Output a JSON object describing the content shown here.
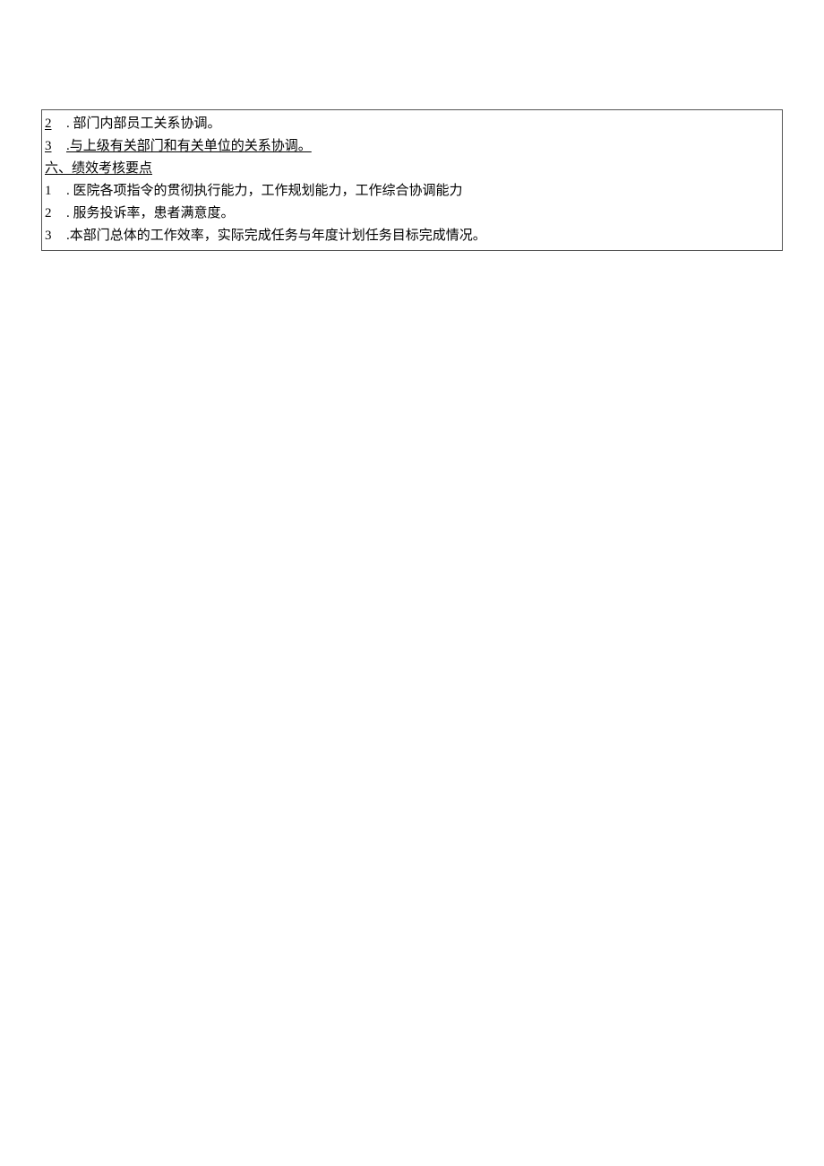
{
  "section_a": {
    "items": [
      {
        "num": "2",
        "text": ". 部门内部员工关系协调。",
        "num_underlined": true,
        "text_underlined": false
      },
      {
        "num": "3",
        "text": ".与上级有关部门和有关单位的关系协调。",
        "num_underlined": true,
        "text_underlined": true
      }
    ]
  },
  "section_b": {
    "heading": "六、绩效考核要点",
    "heading_underlined": true,
    "items": [
      {
        "num": "1",
        "text": ". 医院各项指令的贯彻执行能力，工作规划能力，工作综合协调能力"
      },
      {
        "num": "2",
        "text": ". 服务投诉率，患者满意度。"
      },
      {
        "num": "3",
        "text": ".本部门总体的工作效率，实际完成任务与年度计划任务目标完成情况。"
      }
    ]
  }
}
